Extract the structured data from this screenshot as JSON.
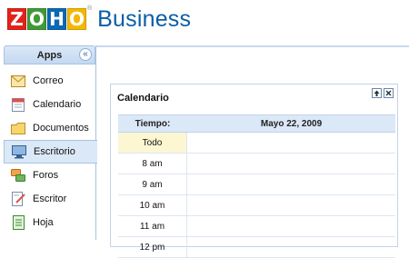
{
  "header": {
    "logo_letters": [
      "Z",
      "O",
      "H",
      "O"
    ],
    "logo_registered": "®",
    "brand": "Business"
  },
  "sidebar": {
    "title": "Apps",
    "collapse_glyph": "«",
    "items": [
      {
        "label": "Correo",
        "icon": "mail-icon"
      },
      {
        "label": "Calendario",
        "icon": "calendar-icon"
      },
      {
        "label": "Documentos",
        "icon": "folder-icon"
      },
      {
        "label": "Escritorio",
        "icon": "desktop-icon",
        "active": true
      },
      {
        "label": "Foros",
        "icon": "forums-icon"
      },
      {
        "label": "Escritor",
        "icon": "writer-icon"
      },
      {
        "label": "Hoja",
        "icon": "sheet-icon"
      }
    ]
  },
  "widget": {
    "title": "Calendario",
    "header_time": "Tiempo:",
    "header_date": "Mayo 22, 2009",
    "rows": [
      "Todo",
      "8 am",
      "9 am",
      "10 am",
      "11 am",
      "12 pm"
    ]
  },
  "colors": {
    "accent": "#0a5ea8",
    "panel": "#dbe8f7",
    "border": "#a8c3e2",
    "allday": "#fdf6d3"
  }
}
